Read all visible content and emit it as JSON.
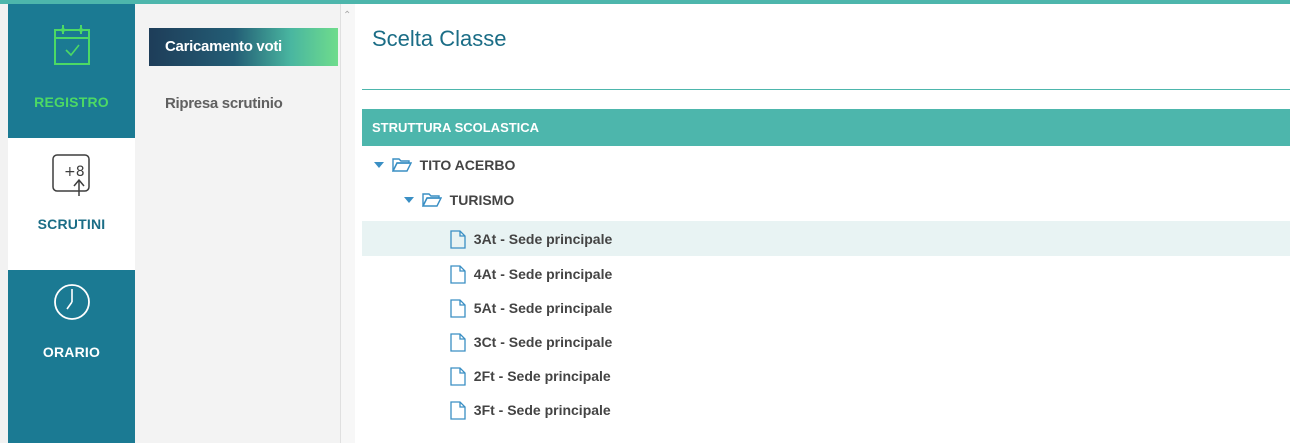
{
  "rail": {
    "items": [
      {
        "id": "registro",
        "label": "REGISTRO",
        "icon": "calendar-check-icon"
      },
      {
        "id": "scrutini",
        "label": "SCRUTINI",
        "icon": "scrutini-plus8-icon"
      },
      {
        "id": "orario",
        "label": "ORARIO",
        "icon": "clock-icon"
      }
    ]
  },
  "submenu": {
    "items": [
      {
        "label": "Caricamento voti",
        "active": true
      },
      {
        "label": "Ripresa scrutinio",
        "active": false
      }
    ]
  },
  "main": {
    "title": "Scelta Classe",
    "section_header": "STRUTTURA SCOLASTICA",
    "tree": {
      "root": "TITO ACERBO",
      "branch": "TURISMO",
      "leaves": [
        "3At - Sede principale",
        "4At - Sede principale",
        "5At - Sede principale",
        "3Ct - Sede principale",
        "2Ft - Sede principale",
        "3Ft - Sede principale"
      ],
      "selected_leaf_index": 0
    }
  },
  "colors": {
    "rail_bg": "#1b7a93",
    "accent_teal": "#4db6ac",
    "registro_green": "#4cd964",
    "title_blue": "#1b6d86",
    "tree_icon_blue": "#3a8fc4"
  }
}
